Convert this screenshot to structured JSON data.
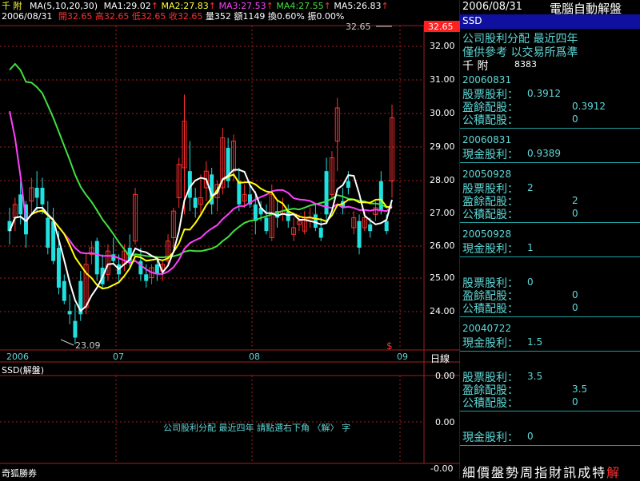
{
  "header": {
    "stock_name": "千  附",
    "ma_params": "MA(5,10,20,30)",
    "ma1": "MA1:29.02",
    "ma2": "MA2:27.83",
    "ma3": "MA3:27.53",
    "ma4": "MA4:27.55",
    "ma5": "MA5:26.83",
    "date": "2006/08/31",
    "open": "開32.65",
    "high": "高32.65",
    "low": "低32.65",
    "close": "收32.65",
    "volume": "量352",
    "amount": "額1149",
    "turnover": "換0.60%",
    "amplitude": "振0.00%",
    "current_price_label": "32.65",
    "price_tag": "32.65"
  },
  "chart": {
    "y_ticks": [
      "32.00",
      "31.00",
      "30.00",
      "29.00",
      "28.00",
      "27.00",
      "26.00",
      "25.00",
      "24.00"
    ],
    "x_labels": [
      "2006",
      "07",
      "08",
      "09"
    ],
    "period_label": "日線",
    "low_annotation": "23.09",
    "s_marker": "$",
    "ma1_color": "#ffffff",
    "ma2_color": "#ffff00",
    "ma3_color": "#ff40ff",
    "ma4_color": "#40e040",
    "up_color": "#ff3030",
    "down_color": "#20e0e0"
  },
  "sub_chart": {
    "title": "SSD(解盤)",
    "y_ticks": [
      "0.00",
      "0.00",
      "-0.00"
    ],
    "notice": "公司股利分配 最近四年   請點選右下角 〈解〉 字"
  },
  "footer": {
    "broker": "奇狐勝券"
  },
  "panel": {
    "date": "2006/08/31",
    "title": "電腦自動解盤",
    "tab": "SSD",
    "subtitle1": "公司股利分配   最近四年",
    "subtitle2": "僅供參考  以交易所爲準",
    "stock_name": "千  附",
    "stock_code": "8383",
    "entries": [
      {
        "date": "20060831",
        "lines": [
          {
            "label": "股票股利：",
            "value": "0.3912"
          },
          {
            "label": "盈餘配股：",
            "value": "0.3912"
          },
          {
            "label": "公積配股：",
            "value": "0"
          }
        ]
      },
      {
        "date": "20060831",
        "lines": [
          {
            "label": "現金股利：",
            "value": "0.9389"
          }
        ]
      },
      {
        "date": "20050928",
        "lines": [
          {
            "label": "股票股利：",
            "value": "2"
          },
          {
            "label": "盈餘配股：",
            "value": "2"
          },
          {
            "label": "公積配股：",
            "value": "0"
          }
        ]
      },
      {
        "date": "20050928",
        "lines": [
          {
            "label": "現金股利：",
            "value": "1"
          }
        ]
      },
      {
        "date": "",
        "lines": [
          {
            "label": "股票股利：",
            "value": "0"
          },
          {
            "label": "盈餘配股：",
            "value": "0"
          },
          {
            "label": "公積配股：",
            "value": "0"
          }
        ]
      },
      {
        "date": "20040722",
        "lines": [
          {
            "label": "現金股利：",
            "value": "1.5"
          }
        ]
      },
      {
        "date": "",
        "lines": [
          {
            "label": "股票股利：",
            "value": "3.5"
          },
          {
            "label": "盈餘配股：",
            "value": "3.5"
          },
          {
            "label": "公積配股：",
            "value": "0"
          }
        ]
      },
      {
        "date": "",
        "lines": [
          {
            "label": "現金股利：",
            "value": "0"
          }
        ]
      }
    ],
    "menu": [
      "細",
      "價",
      "盤",
      "勢",
      "周",
      "指",
      "財",
      "訊",
      "成",
      "特",
      "解"
    ]
  },
  "chart_data": {
    "type": "candlestick",
    "title": "",
    "ylim": [
      23,
      32.6
    ],
    "x": [
      "2006",
      "07",
      "08",
      "09"
    ],
    "candles": [
      [
        26.8,
        27.2,
        26.1,
        26.5
      ],
      [
        26.9,
        27.5,
        26.5,
        27.3
      ],
      [
        27.6,
        28.0,
        26.7,
        27.0
      ],
      [
        27.3,
        27.4,
        26.0,
        26.4
      ],
      [
        27.4,
        28.1,
        27.0,
        27.8
      ],
      [
        27.8,
        28.3,
        27.1,
        27.5
      ],
      [
        27.8,
        28.1,
        27.0,
        27.3
      ],
      [
        26.9,
        27.4,
        25.8,
        26.0
      ],
      [
        26.8,
        27.2,
        25.5,
        25.6
      ],
      [
        26.0,
        26.5,
        24.6,
        24.8
      ],
      [
        25.0,
        25.2,
        24.3,
        24.4
      ],
      [
        24.1,
        24.6,
        23.7,
        24.0
      ],
      [
        23.8,
        24.3,
        23.1,
        23.3
      ],
      [
        25.0,
        25.3,
        23.8,
        24.0
      ],
      [
        24.2,
        25.8,
        24.0,
        25.5
      ],
      [
        25.8,
        26.2,
        25.5,
        26.0
      ],
      [
        26.2,
        26.3,
        25.0,
        25.2
      ],
      [
        25.4,
        25.8,
        24.8,
        24.9
      ],
      [
        25.2,
        26.1,
        25.0,
        25.9
      ],
      [
        25.8,
        26.3,
        25.5,
        25.6
      ],
      [
        25.5,
        25.8,
        25.0,
        25.2
      ],
      [
        25.5,
        26.1,
        25.3,
        25.9
      ],
      [
        26.0,
        26.4,
        25.4,
        25.6
      ],
      [
        26.2,
        27.8,
        26.1,
        27.6
      ],
      [
        25.6,
        26.0,
        25.0,
        25.2
      ],
      [
        25.2,
        25.5,
        24.8,
        25.0
      ],
      [
        25.1,
        25.5,
        24.9,
        25.4
      ],
      [
        25.5,
        25.7,
        25.0,
        25.2
      ],
      [
        25.3,
        25.6,
        25.0,
        25.5
      ],
      [
        25.6,
        26.4,
        25.5,
        26.2
      ],
      [
        26.3,
        27.2,
        26.0,
        27.1
      ],
      [
        27.5,
        28.7,
        27.2,
        28.5
      ],
      [
        28.4,
        30.6,
        27.0,
        29.8
      ],
      [
        28.3,
        29.2,
        27.1,
        27.5
      ],
      [
        27.5,
        27.8,
        26.9,
        27.2
      ],
      [
        27.3,
        28.2,
        27.0,
        27.5
      ],
      [
        27.8,
        28.6,
        27.4,
        28.3
      ],
      [
        28.2,
        28.4,
        27.0,
        27.3
      ],
      [
        27.5,
        28.0,
        27.1,
        27.9
      ],
      [
        27.8,
        29.6,
        27.6,
        29.3
      ],
      [
        29.0,
        29.3,
        27.8,
        28.0
      ],
      [
        28.3,
        29.4,
        28.0,
        29.2
      ],
      [
        28.0,
        28.4,
        27.1,
        27.3
      ],
      [
        27.4,
        27.9,
        27.2,
        27.6
      ],
      [
        27.6,
        27.9,
        27.2,
        27.3
      ],
      [
        27.3,
        27.7,
        26.4,
        26.8
      ],
      [
        27.2,
        27.4,
        26.8,
        27.0
      ],
      [
        26.9,
        27.3,
        26.4,
        26.5
      ],
      [
        26.3,
        27.9,
        26.2,
        27.6
      ],
      [
        27.1,
        27.4,
        26.6,
        26.9
      ],
      [
        27.0,
        27.5,
        26.8,
        27.1
      ],
      [
        27.1,
        27.3,
        26.6,
        26.8
      ],
      [
        26.4,
        26.9,
        26.2,
        26.6
      ],
      [
        26.7,
        27.0,
        26.5,
        26.8
      ],
      [
        26.5,
        27.1,
        26.4,
        26.9
      ],
      [
        26.8,
        27.2,
        26.6,
        26.9
      ],
      [
        27.0,
        27.3,
        26.5,
        26.6
      ],
      [
        26.6,
        26.9,
        26.2,
        26.3
      ],
      [
        28.3,
        28.7,
        26.8,
        27.0
      ],
      [
        27.6,
        28.9,
        27.5,
        28.7
      ],
      [
        29.2,
        30.5,
        28.3,
        30.2
      ],
      [
        27.4,
        27.8,
        27.0,
        27.2
      ],
      [
        28.0,
        28.3,
        27.6,
        27.8
      ],
      [
        26.6,
        27.1,
        26.4,
        26.9
      ],
      [
        26.8,
        27.0,
        25.8,
        26.0
      ],
      [
        26.6,
        27.1,
        26.5,
        26.9
      ],
      [
        26.7,
        26.9,
        26.3,
        26.5
      ],
      [
        27.0,
        27.4,
        26.8,
        27.2
      ],
      [
        28.0,
        28.3,
        27.0,
        27.1
      ],
      [
        26.8,
        27.0,
        26.4,
        26.5
      ],
      [
        28.0,
        30.3,
        27.5,
        29.9
      ]
    ]
  }
}
